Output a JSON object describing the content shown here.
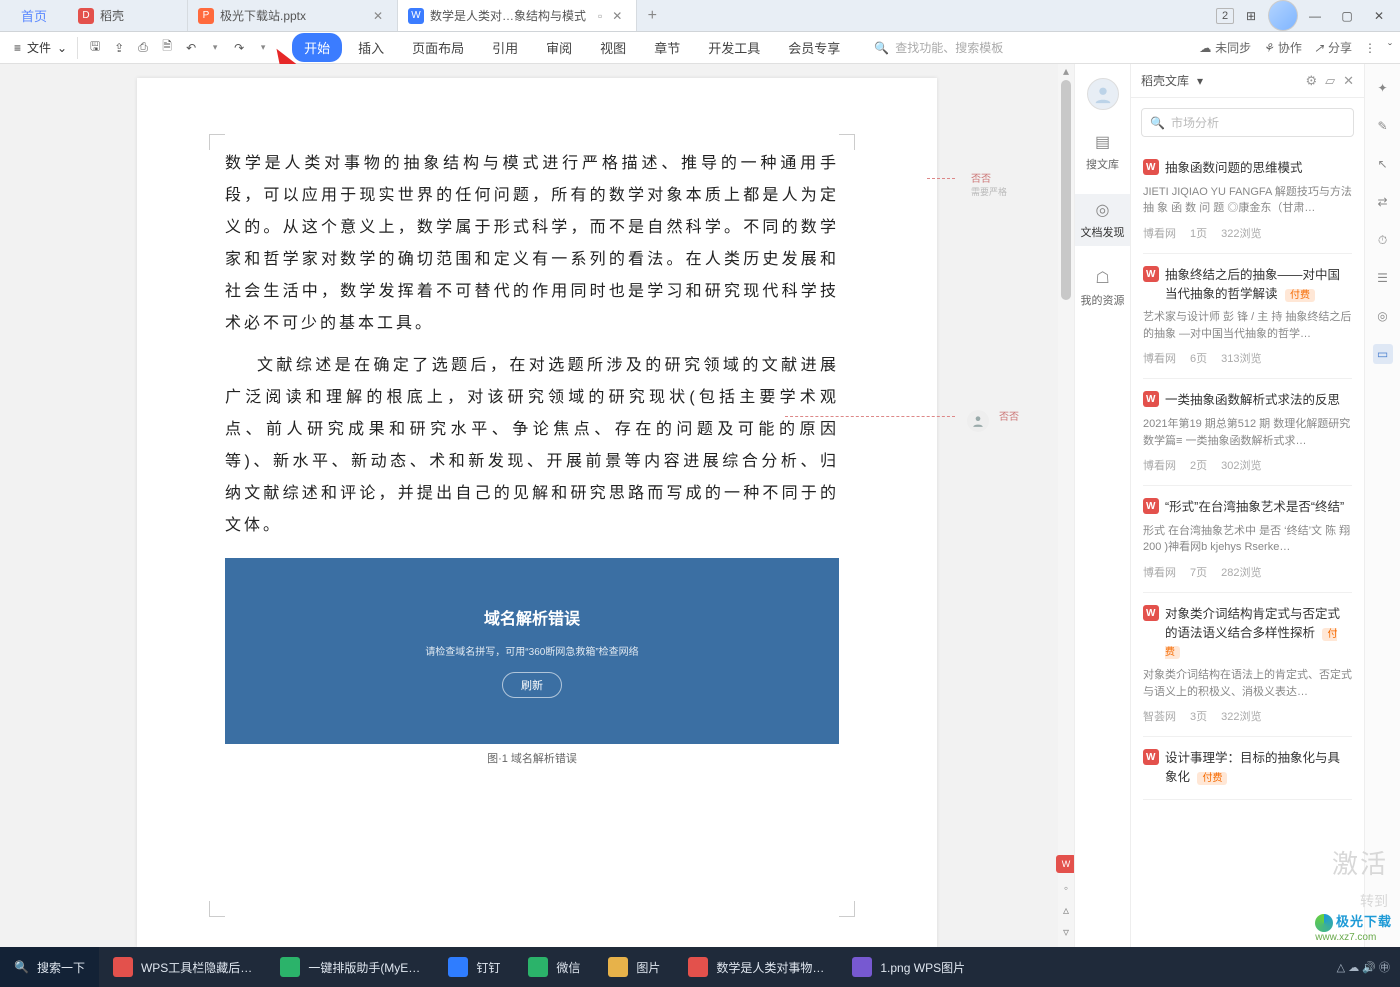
{
  "tabs": {
    "home": "首页",
    "items": [
      {
        "label": "稻壳",
        "icon_bg": "#e3514c"
      },
      {
        "label": "极光下载站.pptx",
        "icon_bg": "#ff6a3d"
      },
      {
        "label": "数学是人类对…象结构与模式",
        "icon_bg": "#3b7cff"
      }
    ]
  },
  "window": {
    "minimize": "—",
    "maximize": "▢",
    "close": "✕",
    "grid": "⊞",
    "num": "2"
  },
  "toolbar": {
    "hamburger": "≡",
    "file": "文件",
    "caret": "⌄",
    "qat": {
      "save": "🖫",
      "export": "⇪",
      "print": "⎙",
      "preview": "🗎",
      "undo": "↶",
      "redo": "↷"
    }
  },
  "menus": [
    "开始",
    "插入",
    "页面布局",
    "引用",
    "审阅",
    "视图",
    "章节",
    "开发工具",
    "会员专享"
  ],
  "search": {
    "icon": "🔍",
    "placeholder": "查找功能、搜索模板"
  },
  "ribbon_right": {
    "unsynced": "未同步",
    "unsynced_icon": "☁",
    "coop": "协作",
    "coop_icon": "⚘",
    "share": "分享",
    "share_icon": "↗",
    "more": "⋮",
    "chev": "ˇ"
  },
  "comments": {
    "name": "否否",
    "note": "需要严格",
    "name2": "否否"
  },
  "document": {
    "p1": "数学是人类对事物的抽象结构与模式进行严格描述、推导的一种通用手段，可以应用于现实世界的任何问题，所有的数学对象本质上都是人为定义的。从这个意义上，数学属于形式科学，而不是自然科学。不同的数学家和哲学家对数学的确切范围和定义有一系列的看法。在人类历史发展和社会生活中，数学发挥着不可替代的作用同时也是学习和研究现代科学技术必不可少的基本工具。",
    "p2": "文献综述是在确定了选题后，在对选题所涉及的研究领域的文献进展广泛阅读和理解的根底上，对该研究领域的研究现状(包括主要学术观点、前人研究成果和研究水平、争论焦点、存在的问题及可能的原因等)、新水平、新动态、术和新发现、开展前景等内容进展综合分析、归纳文献综述和评论，并提出自己的见解和研究思路而写成的一种不同于的文体。",
    "embed_title": "域名解析错误",
    "embed_sub": "请检查域名拼写，可用“360断网急救箱”检查网络",
    "embed_btn": "刷新",
    "caption": "图·1 域名解析错误"
  },
  "panel_nav": {
    "search": "搜文库",
    "discover": "文档发现",
    "mine": "我的资源"
  },
  "library": {
    "title": "稻壳文库",
    "caret": "▾",
    "icons": {
      "gear": "⚙",
      "bell": "▱",
      "close": "✕"
    },
    "search_placeholder": "市场分析",
    "cards": [
      {
        "title": "抽象函数问题的思维模式",
        "desc": "JIETI JIQIAO YU FANGFA 解题技巧与方法 抽 象 函 数 问 题 ◎康金东（甘肃…",
        "source": "博看网",
        "pages": "1页",
        "views": "322浏览",
        "pay": false
      },
      {
        "title": "抽象终结之后的抽象——对中国当代抽象的哲学解读",
        "desc": "艺术家与设计师 彭 锋 / 主 持 抽象终结之后的抽象 —对中国当代抽象的哲学…",
        "source": "博看网",
        "pages": "6页",
        "views": "313浏览",
        "pay": true
      },
      {
        "title": "一类抽象函数解析式求法的反思",
        "desc": "2021年第19 期总第512 期 数理化解题研究 数学篇≡ 一类抽象函数解析式求…",
        "source": "博看网",
        "pages": "2页",
        "views": "302浏览",
        "pay": false
      },
      {
        "title": "“形式”在台湾抽象艺术是否“终结”",
        "desc": "形式 在台湾抽象艺术中 是否 ‘终结’文 陈 翔 200 )神看网b kjehys Rserke…",
        "source": "博看网",
        "pages": "7页",
        "views": "282浏览",
        "pay": false
      },
      {
        "title": "对象类介词结构肯定式与否定式的语法语义结合多样性探析",
        "desc": "对象类介词结构在语法上的肯定式、否定式与语义上的积极义、消极义表达…",
        "source": "智荟网",
        "pages": "3页",
        "views": "322浏览",
        "pay": true
      },
      {
        "title": "设计事理学：目标的抽象化与具象化",
        "desc": "",
        "source": "",
        "pages": "",
        "views": "",
        "pay": true
      }
    ],
    "pay_label": "付费"
  },
  "rstrip_icons": [
    "✦",
    "✎",
    "↖",
    "⇄",
    "⏱",
    "☰",
    "◎",
    "▭"
  ],
  "watermark": {
    "big": "激活",
    "small": "转到"
  },
  "taskbar": {
    "search": "搜索一下",
    "items": [
      {
        "label": "WPS工具栏隐藏后…",
        "color": "#e3514c"
      },
      {
        "label": "一键排版助手(MyE…",
        "color": "#2bb36a"
      },
      {
        "label": "钉钉",
        "color": "#2f7dff"
      },
      {
        "label": "微信",
        "color": "#2bb36a"
      },
      {
        "label": "图片",
        "color": "#e7b24a"
      },
      {
        "label": "数学是人类对事物…",
        "color": "#e3514c"
      },
      {
        "label": "1.png  WPS图片",
        "color": "#7759d1"
      }
    ],
    "tray": "△ ☁ 🔊  ㊥",
    "brand": "极光下载",
    "url": "www.xz7.com"
  }
}
